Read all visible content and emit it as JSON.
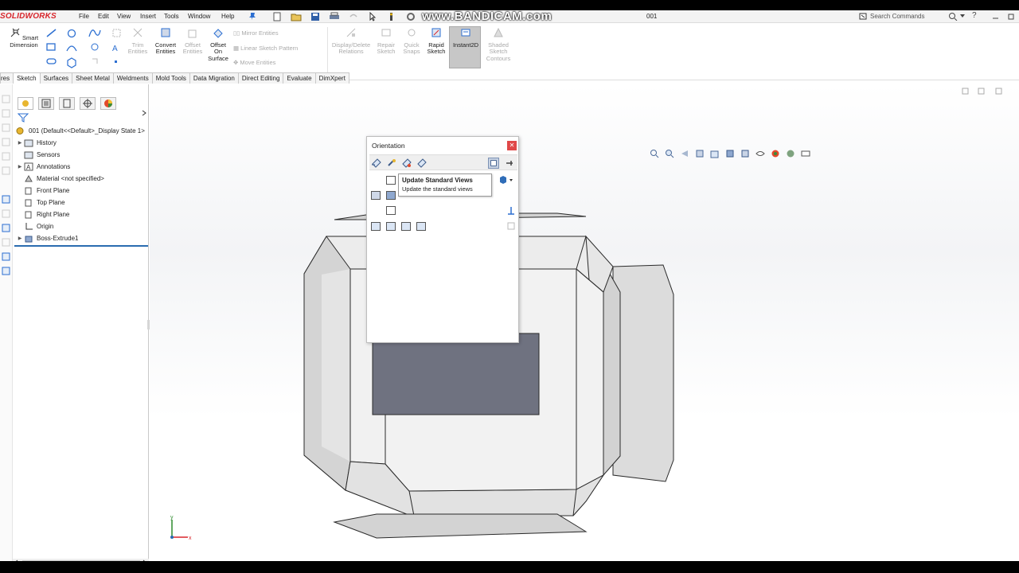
{
  "app": {
    "name": "SOLIDWORKS",
    "document": "001",
    "watermark": "www.BANDICAM.com"
  },
  "menu": [
    "File",
    "Edit",
    "View",
    "Insert",
    "Tools",
    "Window",
    "Help"
  ],
  "search": {
    "placeholder": "Search Commands"
  },
  "ribbon": {
    "smart_dimension": "Smart Dimension",
    "trim_entities": "Trim Entities",
    "convert_entities": "Convert Entities",
    "offset_entities": "Offset Entities",
    "offset_on_surface": "Offset On Surface",
    "mirror_entities": "Mirror Entities",
    "linear_sketch_pattern": "Linear Sketch Pattern",
    "move_entities": "Move Entities",
    "display_delete_relations": "Display/Delete Relations",
    "repair_sketch": "Repair Sketch",
    "quick_snaps": "Quick Snaps",
    "rapid_sketch": "Rapid Sketch",
    "instant2d": "Instant2D",
    "shaded_sketch_contours": "Shaded Sketch Contours"
  },
  "tabs": [
    "res",
    "Sketch",
    "Surfaces",
    "Sheet Metal",
    "Weldments",
    "Mold Tools",
    "Data Migration",
    "Direct Editing",
    "Evaluate",
    "DimXpert"
  ],
  "tree": {
    "root": "001  (Default<<Default>_Display State 1>",
    "items": [
      "History",
      "Sensors",
      "Annotations",
      "Material <not specified>",
      "Front Plane",
      "Top Plane",
      "Right Plane",
      "Origin",
      "Boss-Extrude1"
    ]
  },
  "orientation": {
    "title": "Orientation",
    "tooltip_title": "Update Standard Views",
    "tooltip_desc": "Update the standard views"
  },
  "colors": {
    "brand": "#d8262c",
    "selection_line": "#2b6cb0",
    "model_face": "#d8d8d8",
    "model_dark": "#6f7280"
  }
}
